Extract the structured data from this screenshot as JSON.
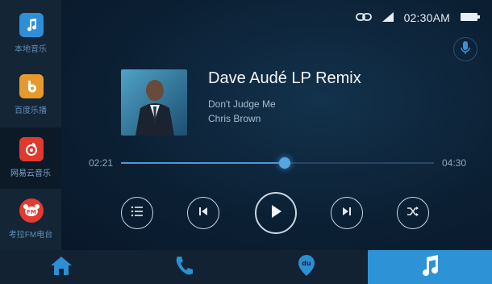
{
  "sidebar": {
    "apps": [
      {
        "label": "本地音乐",
        "icon": "music-note-icon",
        "color": "#2e8fd8"
      },
      {
        "label": "百度乐播",
        "icon": "baidu-lebo-icon",
        "color": "#e69a2e"
      },
      {
        "label": "网易云音乐",
        "icon": "netease-music-icon",
        "color": "#e03a2e"
      },
      {
        "label": "考拉FM电台",
        "icon": "kaola-fm-icon",
        "color": "#e23b2f"
      }
    ],
    "active_index": 2
  },
  "status": {
    "time": "02:30AM",
    "icons": [
      "link-icon",
      "signal-icon",
      "battery-icon"
    ]
  },
  "player": {
    "title": "Dave Audé LP Remix",
    "album": "Don't Judge Me",
    "artist": "Chris Brown",
    "current_time": "02:21",
    "total_time": "04:30",
    "progress": 0.522
  },
  "controls": [
    "playlist-icon",
    "previous-icon",
    "play-icon",
    "next-icon",
    "shuffle-icon"
  ],
  "bottom_tabs": [
    "home-icon",
    "phone-icon",
    "navigation-icon",
    "music-icon"
  ],
  "colors": {
    "accent": "#2d93d6",
    "background": "#0a1a2b"
  }
}
